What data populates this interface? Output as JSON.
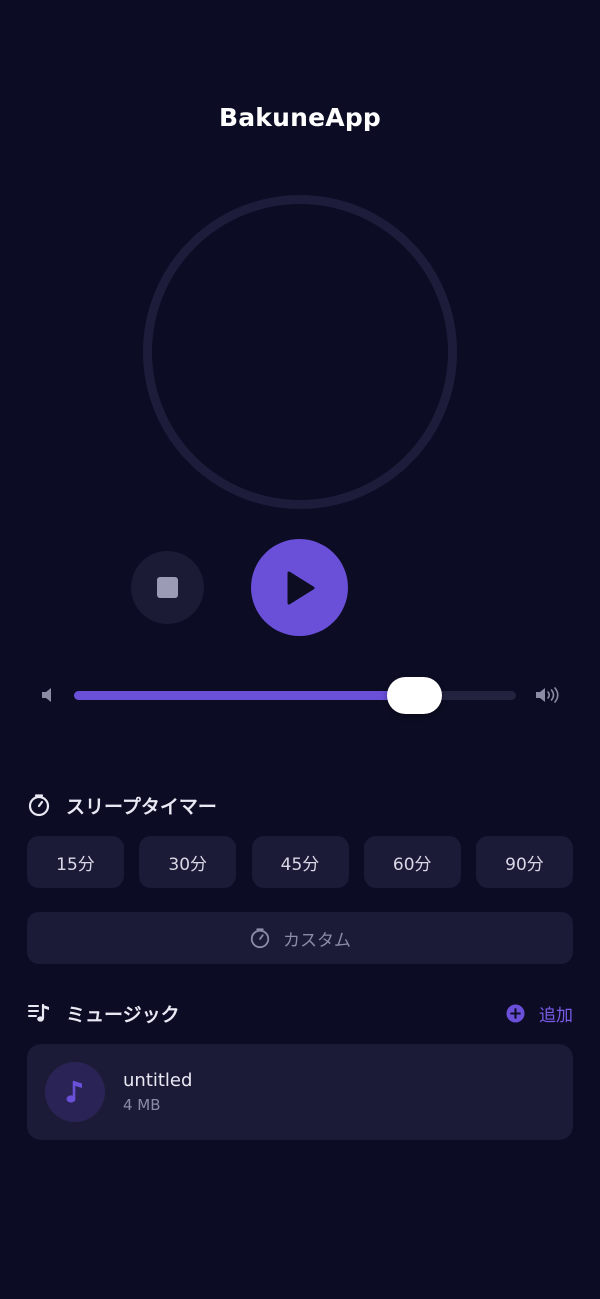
{
  "app": {
    "title": "BakuneApp"
  },
  "player": {
    "icons": {
      "center": "moon-icon",
      "stop": "stop-icon",
      "play": "play-icon"
    },
    "accent_color": "#6a4fd8"
  },
  "volume": {
    "level": 0.77,
    "icons": {
      "low": "volume-low-icon",
      "high": "volume-high-icon"
    }
  },
  "sleep_timer": {
    "heading": "スリープタイマー",
    "icon": "timer-icon",
    "options": [
      "15分",
      "30分",
      "45分",
      "60分",
      "90分"
    ],
    "custom_label": "カスタム"
  },
  "music": {
    "heading": "ミュージック",
    "icon": "music-list-icon",
    "add_label": "追加",
    "items": [
      {
        "name": "untitled",
        "size": "4 MB",
        "icon": "music-note-icon"
      }
    ]
  }
}
